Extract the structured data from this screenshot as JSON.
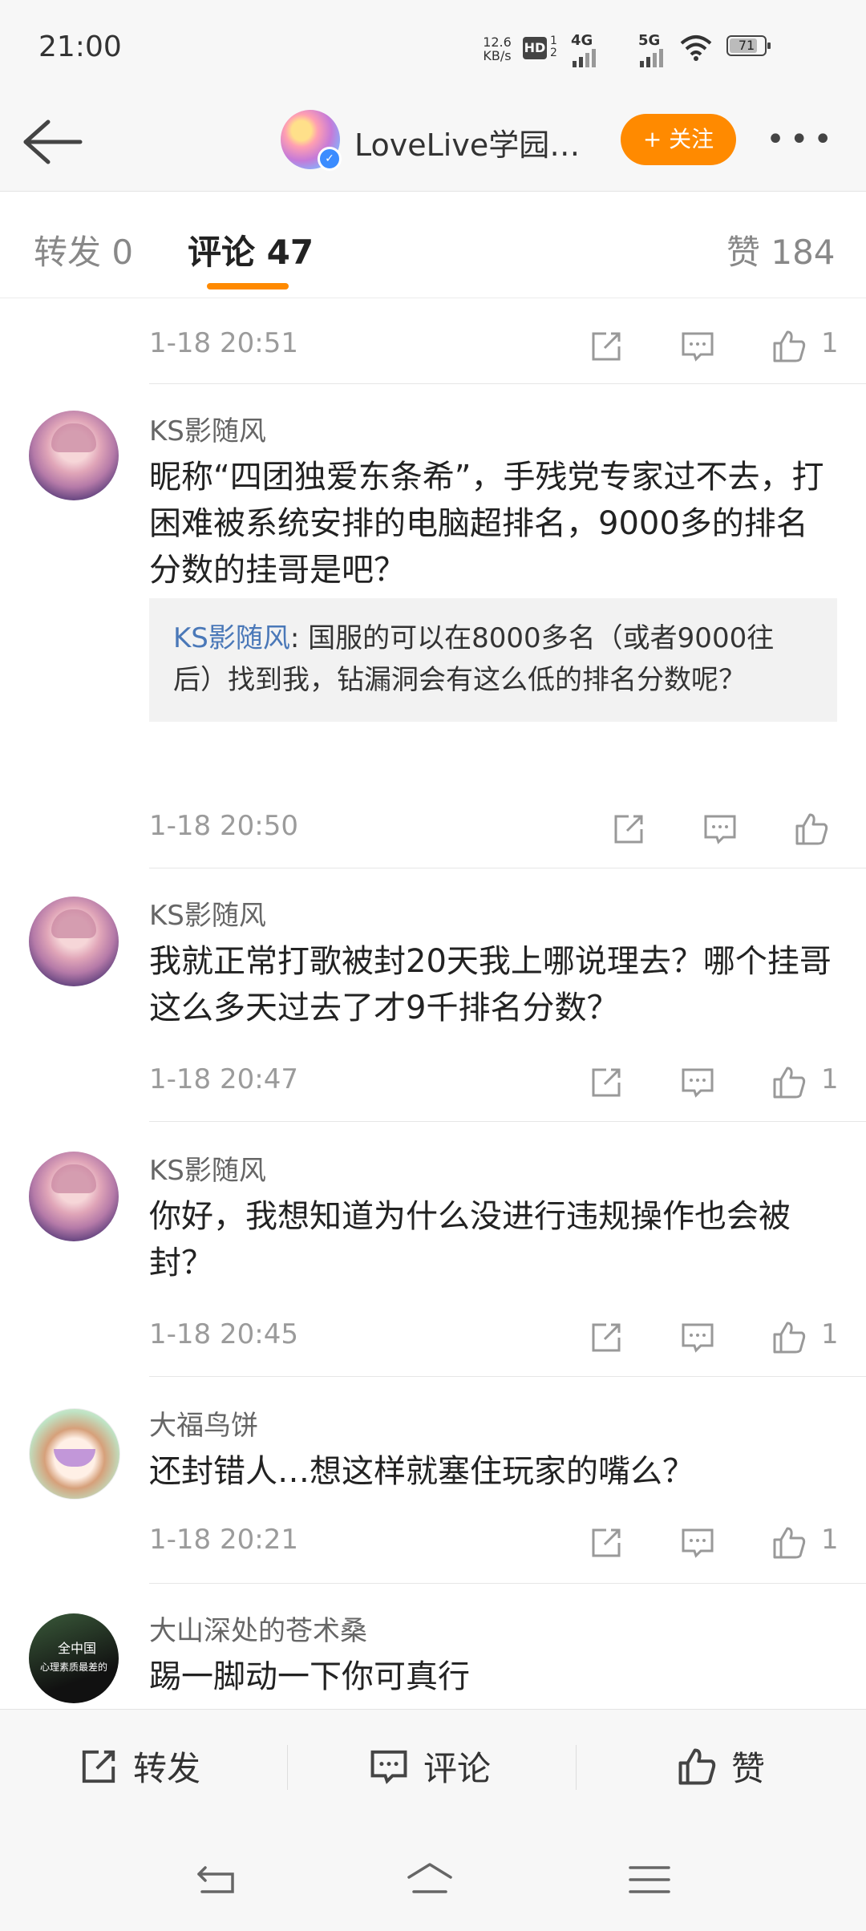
{
  "status_bar": {
    "time": "21:00",
    "net_speed_value": "12.6",
    "net_speed_unit": "KB/s",
    "hd_label": "HD",
    "hd_sub": "1 2",
    "net1": "4G",
    "net2": "5G",
    "battery": "71"
  },
  "nav": {
    "title": "LoveLive学园…",
    "follow_label": "+ 关注",
    "more_label": "•••",
    "verified_badge": "✓"
  },
  "tabs": [
    {
      "label": "转发 0",
      "active": false
    },
    {
      "label": "评论 47",
      "active": true
    },
    {
      "label": "赞 184",
      "active": false
    }
  ],
  "comments": [
    {
      "user": "",
      "text": "",
      "date": "1-18 20:51",
      "likes": "1"
    },
    {
      "user": "KS影随风",
      "text": "昵称“四团独爱东条希”，手残党专家过不去，打困难被系统安排的电脑超排名，9000多的排名分数的挂哥是吧？",
      "quote_user": "KS影随风",
      "quote_text": ": 国服的可以在8000多名（或者9000往后）找到我，钻漏洞会有这么低的排名分数呢？",
      "date": "1-18 20:50",
      "likes": ""
    },
    {
      "user": "KS影随风",
      "text": "我就正常打歌被封20天我上哪说理去？哪个挂哥这么多天过去了才9千排名分数？",
      "date": "1-18 20:47",
      "likes": "1"
    },
    {
      "user": "KS影随风",
      "text": "你好，我想知道为什么没进行违规操作也会被封？",
      "date": "1-18 20:45",
      "likes": "1"
    },
    {
      "user": "大福鸟饼",
      "text": "还封错人…想这样就塞住玩家的嘴么？",
      "date": "1-18 20:21",
      "likes": "1"
    },
    {
      "user": "大山深处的苍术桑",
      "text": "踢一脚动一下你可真行",
      "avatar_text_1": "全中国",
      "avatar_text_2": "心理素质最差的"
    }
  ],
  "bottom_bar": {
    "repost": "转发",
    "comment": "评论",
    "like": "赞"
  },
  "icons": {
    "share": "share-icon",
    "comment": "comment-icon",
    "like": "thumbs-up-icon"
  },
  "colors": {
    "accent": "#ff8a00",
    "link": "#4a78b8",
    "verified": "#3b8cff"
  }
}
